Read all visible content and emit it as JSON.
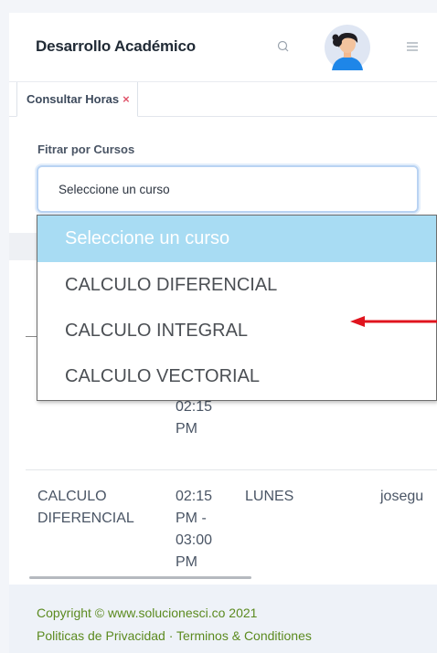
{
  "header": {
    "title": "Desarrollo Académico",
    "search_icon": "search-icon",
    "menu_icon": "hamburger-menu-icon"
  },
  "tabs": [
    {
      "label": "Consultar Horas",
      "close": "×"
    }
  ],
  "filter": {
    "label": "Fitrar por Cursos",
    "selected_value": "Seleccione un curso"
  },
  "dropdown": {
    "options": [
      "Seleccione un curso",
      "CALCULO DIFERENCIAL",
      "CALCULO INTEGRAL",
      "CALCULO VECTORIAL"
    ],
    "highlighted_index": 0,
    "highlight_color": "#a8dcf3"
  },
  "table": {
    "partial_row_time": [
      "02:15",
      "PM"
    ],
    "row": {
      "course": [
        "CALCULO",
        "DIFERENCIAL"
      ],
      "time": [
        "02:15",
        "PM -",
        "03:00",
        "PM"
      ],
      "day": "LUNES",
      "user": "josegu"
    }
  },
  "annotation": {
    "arrow_color": "#e0141e"
  },
  "footer": {
    "copyright": "Copyright © www.solucionesci.co 2021",
    "policies": "Politicas de Privacidad · Terminos & Conditiones"
  }
}
